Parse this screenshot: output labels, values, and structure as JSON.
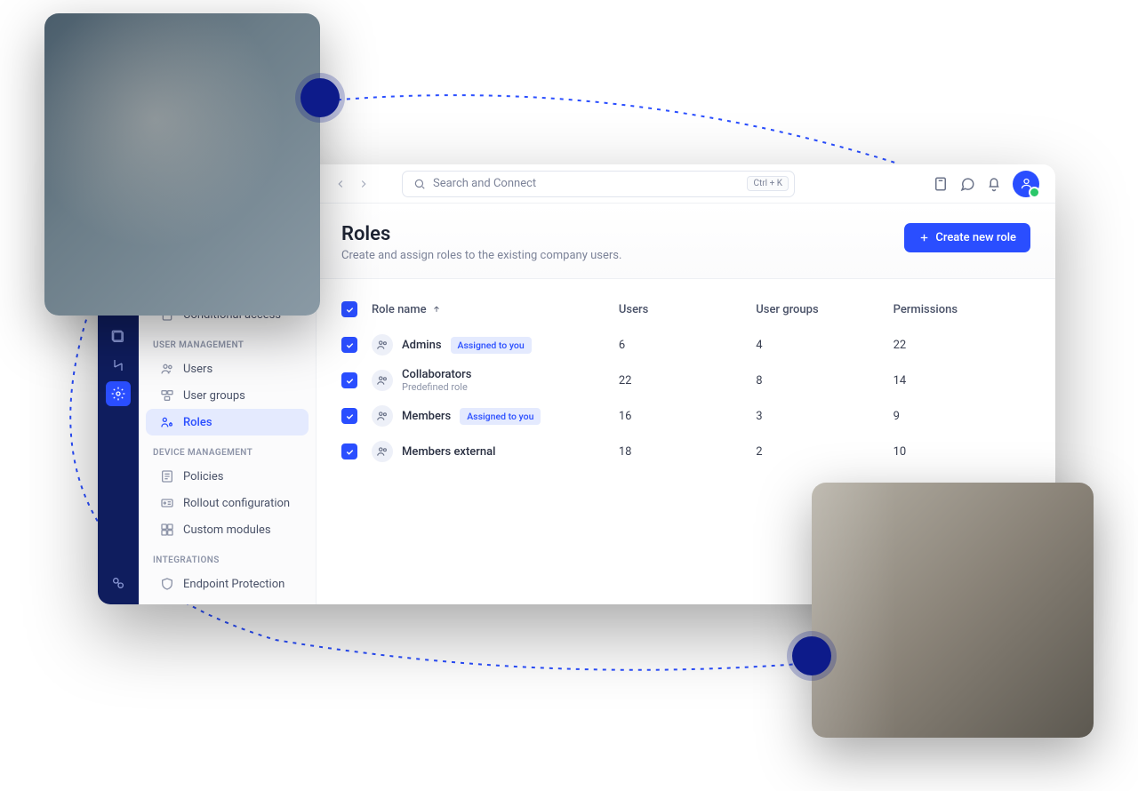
{
  "search": {
    "placeholder": "Search and Connect",
    "shortcut": "Ctrl + K"
  },
  "header": {
    "title": "Roles",
    "subtitle": "Create and assign roles to the existing company users.",
    "create_btn": "Create new role"
  },
  "sidebar": {
    "top_item": "Conditional access",
    "sections": [
      {
        "label": "USER MANAGEMENT",
        "items": [
          {
            "label": "Users",
            "icon": "users"
          },
          {
            "label": "User groups",
            "icon": "user-groups"
          },
          {
            "label": "Roles",
            "icon": "roles",
            "active": true
          }
        ]
      },
      {
        "label": "DEVICE MANAGEMENT",
        "items": [
          {
            "label": "Policies",
            "icon": "policies"
          },
          {
            "label": "Rollout configuration",
            "icon": "rollout"
          },
          {
            "label": "Custom modules",
            "icon": "modules"
          }
        ]
      },
      {
        "label": "INTEGRATIONS",
        "items": [
          {
            "label": "Endpoint Protection",
            "icon": "shield"
          }
        ]
      }
    ]
  },
  "table": {
    "columns": {
      "role": "Role name",
      "users": "Users",
      "groups": "User groups",
      "permissions": "Permissions"
    },
    "rows": [
      {
        "name": "Admins",
        "badge": "Assigned to you",
        "users": "6",
        "groups": "4",
        "permissions": "22"
      },
      {
        "name": "Collaborators",
        "sub": "Predefined role",
        "users": "22",
        "groups": "8",
        "permissions": "14"
      },
      {
        "name": "Members",
        "badge": "Assigned to you",
        "users": "16",
        "groups": "3",
        "permissions": "9"
      },
      {
        "name": "Members external",
        "users": "18",
        "groups": "2",
        "permissions": "10"
      }
    ]
  }
}
